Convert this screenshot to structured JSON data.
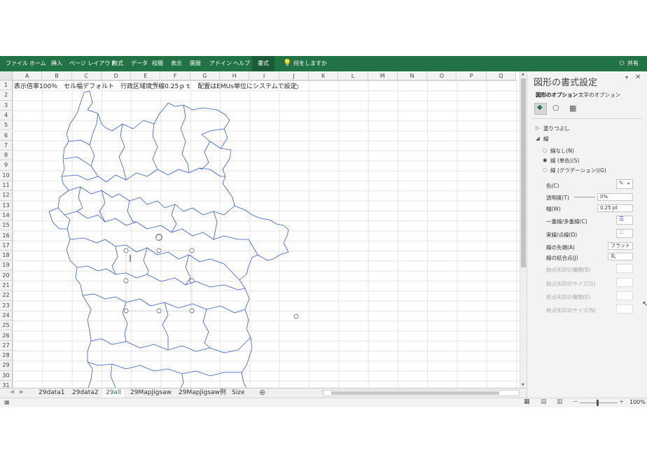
{
  "ribbon": {
    "tabs": [
      "ファイル",
      "ホーム",
      "挿入",
      "ページ レイアウト",
      "数式",
      "データ",
      "校閲",
      "表示",
      "開発",
      "アドイン",
      "ヘルプ",
      "書式"
    ],
    "active_tab": "書式",
    "tell_me": "何をしますか",
    "share": "共有"
  },
  "sheet": {
    "columns": [
      "A",
      "B",
      "C",
      "D",
      "E",
      "F",
      "G",
      "H",
      "I",
      "J",
      "K",
      "L",
      "M",
      "N",
      "O",
      "P",
      "Q"
    ],
    "rows": [
      "1",
      "2",
      "3",
      "4",
      "5",
      "6",
      "7",
      "8",
      "9",
      "10",
      "11",
      "12",
      "13",
      "14",
      "15",
      "16",
      "17",
      "18",
      "19",
      "20",
      "21",
      "22",
      "23",
      "24",
      "25",
      "26",
      "27",
      "28",
      "29",
      "30",
      "31"
    ],
    "a1_text": "表示倍率100％　セル幅デフォルト　行政区域境界線0.25ｐｔ　配置はEMUs単位にシステムで設定"
  },
  "sheet_tabs": [
    "29data1",
    "29data2",
    "29all",
    "29MapJigsaw",
    "29MapJigsaw例",
    "Size"
  ],
  "active_sheet": "29all",
  "status": {
    "zoom": "100%"
  },
  "pane": {
    "title": "図形の書式設定",
    "tab_shape": "図形のオプション",
    "tab_text": "文字のオプション",
    "section_fill": "塗りつぶし",
    "section_line": "線",
    "radio_none": "線なし(N)",
    "radio_solid": "線 (単色)(S)",
    "radio_gradient": "線 (グラデーション)(G)",
    "color_label": "色(C)",
    "transparency_label": "透明度(T)",
    "transparency_value": "0%",
    "width_label": "幅(W)",
    "width_value": "0.25 pt",
    "compound_label": "一重線/多重線(C)",
    "dash_label": "実線/点線(D)",
    "cap_label": "線の先端(A)",
    "cap_value": "フラット",
    "join_label": "線の結合点(J)",
    "join_value": "丸",
    "begin_arrow_type": "始点矢印の種類(B)",
    "begin_arrow_size": "始点矢印のサイズ(S)",
    "end_arrow_type": "終点矢印の種類(E)",
    "end_arrow_size": "終点矢印のサイズ(N)"
  },
  "colors": {
    "ribbon": "#217346",
    "map_line": "#2f5fd0",
    "accent": "#217346"
  }
}
